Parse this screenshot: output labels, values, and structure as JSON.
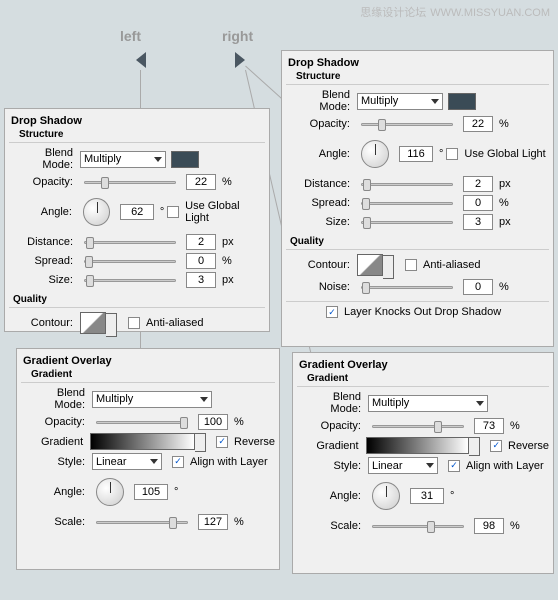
{
  "watermark": {
    "cn": "思缘设计论坛",
    "en": "WWW.MISSYUAN.COM"
  },
  "labels": {
    "left": "left",
    "right": "right"
  },
  "common": {
    "dropShadow": "Drop Shadow",
    "structure": "Structure",
    "quality": "Quality",
    "gradientOverlay": "Gradient Overlay",
    "gradient": "Gradient",
    "blendMode": "Blend Mode:",
    "opacity": "Opacity:",
    "angle": "Angle:",
    "distance": "Distance:",
    "spread": "Spread:",
    "size": "Size:",
    "contour": "Contour:",
    "noise": "Noise:",
    "style": "Style:",
    "scale": "Scale:",
    "deg": "°",
    "pct": "%",
    "px": "px",
    "useGlobal": "Use Global Light",
    "antiAliased": "Anti-aliased",
    "knockout": "Layer Knocks Out Drop Shadow",
    "reverse": "Reverse",
    "alignLayer": "Align with Layer",
    "multiply": "Multiply",
    "linear": "Linear"
  },
  "leftDS": {
    "opacity": "22",
    "angle": "62",
    "distance": "2",
    "spread": "0",
    "size": "3"
  },
  "rightDS": {
    "opacity": "22",
    "angle": "116",
    "distance": "2",
    "spread": "0",
    "size": "3",
    "noise": "0"
  },
  "leftGO": {
    "opacity": "100",
    "angle": "105",
    "scale": "127"
  },
  "rightGO": {
    "opacity": "73",
    "angle": "31",
    "scale": "98"
  }
}
